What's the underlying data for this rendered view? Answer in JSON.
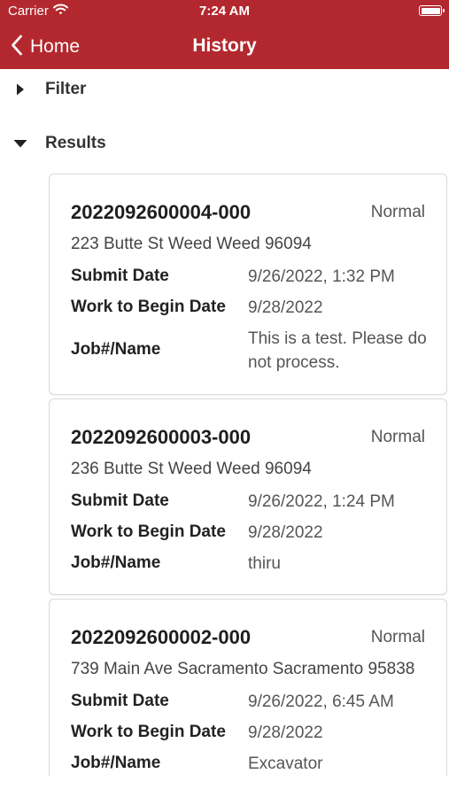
{
  "status_bar": {
    "carrier": "Carrier",
    "time": "7:24 AM"
  },
  "nav": {
    "back_label": "Home",
    "title": "History"
  },
  "sections": {
    "filter": {
      "label": "Filter",
      "expanded": false
    },
    "results": {
      "label": "Results",
      "expanded": true
    }
  },
  "labels": {
    "submit_date": "Submit Date",
    "work_to_begin_date": "Work to Begin Date",
    "job_name": "Job#/Name"
  },
  "results": [
    {
      "id": "2022092600004-000",
      "priority": "Normal",
      "address": "223 Butte St Weed Weed 96094",
      "submit_date": "9/26/2022, 1:32 PM",
      "work_to_begin_date": "9/28/2022",
      "job_name": "This is a test. Please do not process."
    },
    {
      "id": "2022092600003-000",
      "priority": "Normal",
      "address": "236 Butte St Weed Weed 96094",
      "submit_date": "9/26/2022, 1:24 PM",
      "work_to_begin_date": "9/28/2022",
      "job_name": "thiru"
    },
    {
      "id": "2022092600002-000",
      "priority": "Normal",
      "address": "739 Main Ave Sacramento Sacramento 95838",
      "submit_date": "9/26/2022, 6:45 AM",
      "work_to_begin_date": "9/28/2022",
      "job_name": "Excavator"
    }
  ],
  "colors": {
    "header_background": "#b3282e",
    "header_text": "#ffffff"
  }
}
